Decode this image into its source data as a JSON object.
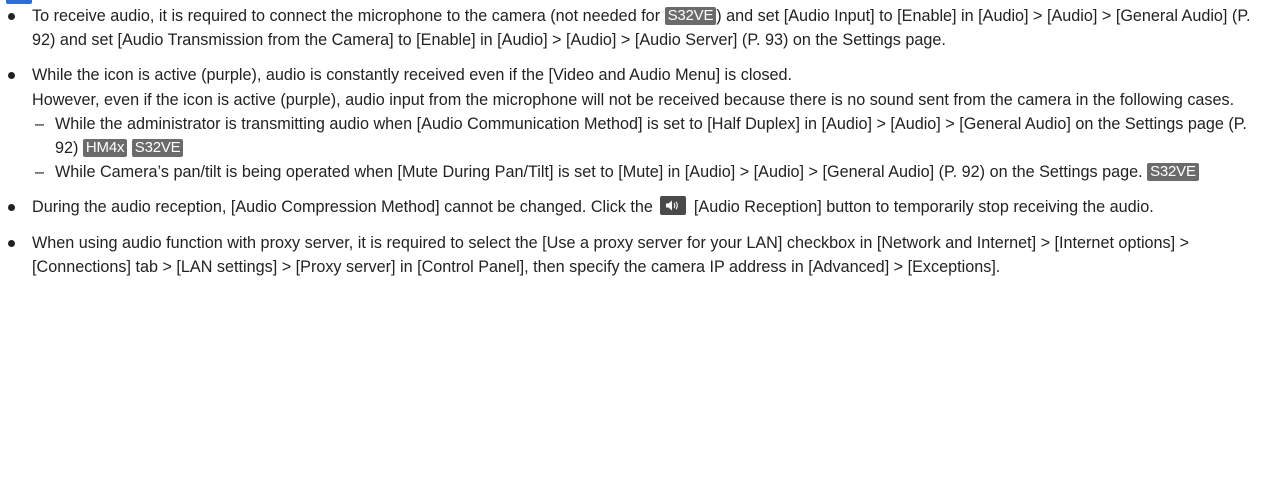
{
  "notes": [
    {
      "p1": "To receive audio, it is required to connect the microphone to the camera (not needed for ",
      "tag": "S32VE",
      "p2": ") and set [Audio Input] to [Enable] in [Audio] > [Audio] > [General Audio] (P. 92) and set [Audio Transmission from the Camera] to [Enable] in [Audio] > [Audio] > [Audio Server] (P. 93) on the Settings page."
    },
    {
      "line1": "While the icon is active (purple), audio is constantly received even if the [Video and Audio Menu] is closed.",
      "line2": "However, even if the icon is active (purple), audio input from the microphone will not be received because there is no sound sent from the camera in the following cases.",
      "cases": [
        {
          "dash": "–",
          "text": "While the administrator is transmitting audio when [Audio Communication Method] is set to [Half Duplex] in [Audio] > [Audio] > [General Audio] on the Settings page (P. 92)",
          "tag1": "HM4x",
          "tag2": "S32VE"
        },
        {
          "dash": "–",
          "text": "While Camera’s pan/tilt is being operated when [Mute During Pan/Tilt] is set to [Mute] in [Audio] > [Audio] > [General Audio] (P. 92) on the Settings page.",
          "tag1": "S32VE"
        }
      ]
    },
    {
      "p1": "During the audio reception, [Audio Compression Method] cannot be changed. Click the",
      "icon": "speaker-icon",
      "p2": "[Audio Reception] button to temporarily stop receiving the audio."
    },
    {
      "p1": "When using audio function with proxy server, it is required to select the [Use a proxy server for your LAN] checkbox in [Network and Internet] > [Internet options] > [Connections] tab > [LAN settings] > [Proxy server] in [Control Panel], then specify the camera IP address in [Advanced] > [Exceptions]."
    }
  ],
  "colors": {
    "text": "#222222",
    "tag_bg": "#6b6b6b",
    "button_bg": "#4a4a4a",
    "top_mark": "#2a6fd6"
  }
}
